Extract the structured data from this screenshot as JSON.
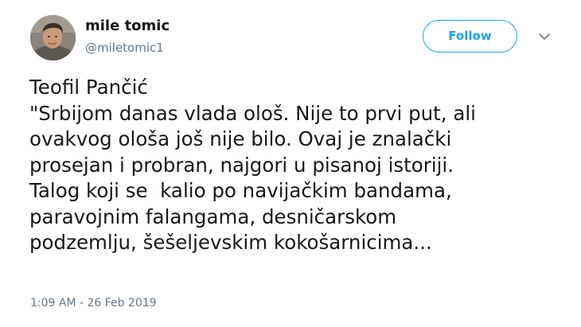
{
  "user": {
    "display_name": "mile tomic",
    "screen_name": "@miletomic1",
    "avatar_icon": "profile-photo-icon"
  },
  "actions": {
    "follow_label": "Follow",
    "menu_icon": "chevron-down-icon"
  },
  "tweet": {
    "lines": [
      "Teofil Pančić",
      "\"Srbijom danas vlada ološ. Nije to prvi put, ali",
      "ovakvog ološa još nije bilo. Ovaj je znalački",
      "prosejan i probran, najgori u pisanoj istoriji.",
      "Talog koji se  kalio po navijačkim bandama,",
      "paravojnim falangama, desničarskom",
      "podzemlju, šešeljevskim kokošarnicima..."
    ],
    "timestamp": "1:09 AM - 26 Feb 2019"
  },
  "colors": {
    "accent": "#1da1f2",
    "text": "#14171a",
    "secondary_text": "#657786"
  }
}
